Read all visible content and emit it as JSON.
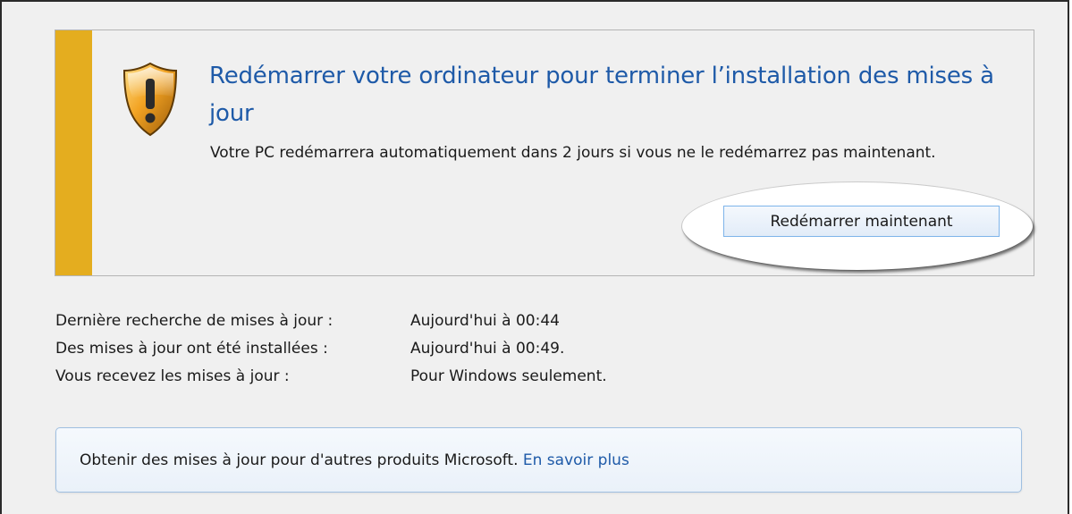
{
  "alert": {
    "title": "Redémarrer votre ordinateur pour terminer l’installation des mises à jour",
    "description": "Votre PC redémarrera automatiquement dans 2 jours si vous ne le redémarrez pas maintenant.",
    "restart_button": "Redémarrer maintenant",
    "icon": "warning-shield-icon"
  },
  "status": [
    {
      "label": "Dernière recherche de mises à jour :",
      "value": "Aujourd'hui à 00:44"
    },
    {
      "label": "Des mises à jour ont été installées :",
      "value": "Aujourd'hui à 00:49."
    },
    {
      "label": "Vous recevez les mises à jour :",
      "value": "Pour Windows seulement."
    }
  ],
  "notice": {
    "text": "Obtenir des mises à jour pour d'autres produits Microsoft.",
    "link": "En savoir plus"
  },
  "colors": {
    "title_blue": "#1e5aa8",
    "stripe_amber": "#e4ad1f",
    "panel_bg": "#f0f0f0"
  }
}
